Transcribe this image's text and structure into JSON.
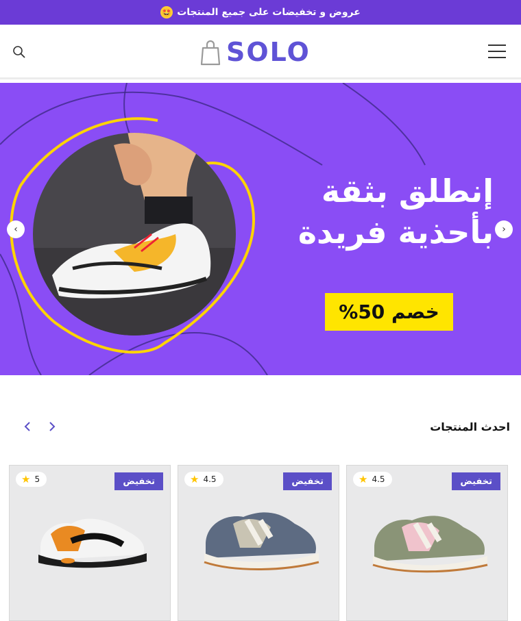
{
  "topbar": {
    "text": "عروض و تخفيضات على جميع المنتجات",
    "emoji": "🤩"
  },
  "header": {
    "logo_text": "SOLO",
    "icons": {
      "menu": "hamburger-menu-icon",
      "search": "search-icon",
      "logo": "shopping-bag-icon"
    }
  },
  "hero": {
    "title_line1": "إنطلق بثقة",
    "title_line2": "بأحذية فريدة",
    "discount": "خصم 50%",
    "prev": "‹",
    "next": "›"
  },
  "colors": {
    "topbar": "#6b3bd6",
    "hero": "#8a4df5",
    "accent": "#ffe500",
    "badge": "#5b4fc7",
    "logo": "#5f53d6"
  },
  "section": {
    "title": "احدث المنتجات"
  },
  "products": [
    {
      "badge": "تخفيض",
      "rating": "4.5"
    },
    {
      "badge": "تخفيض",
      "rating": "4.5"
    },
    {
      "badge": "تخفيض",
      "rating": "5"
    }
  ]
}
